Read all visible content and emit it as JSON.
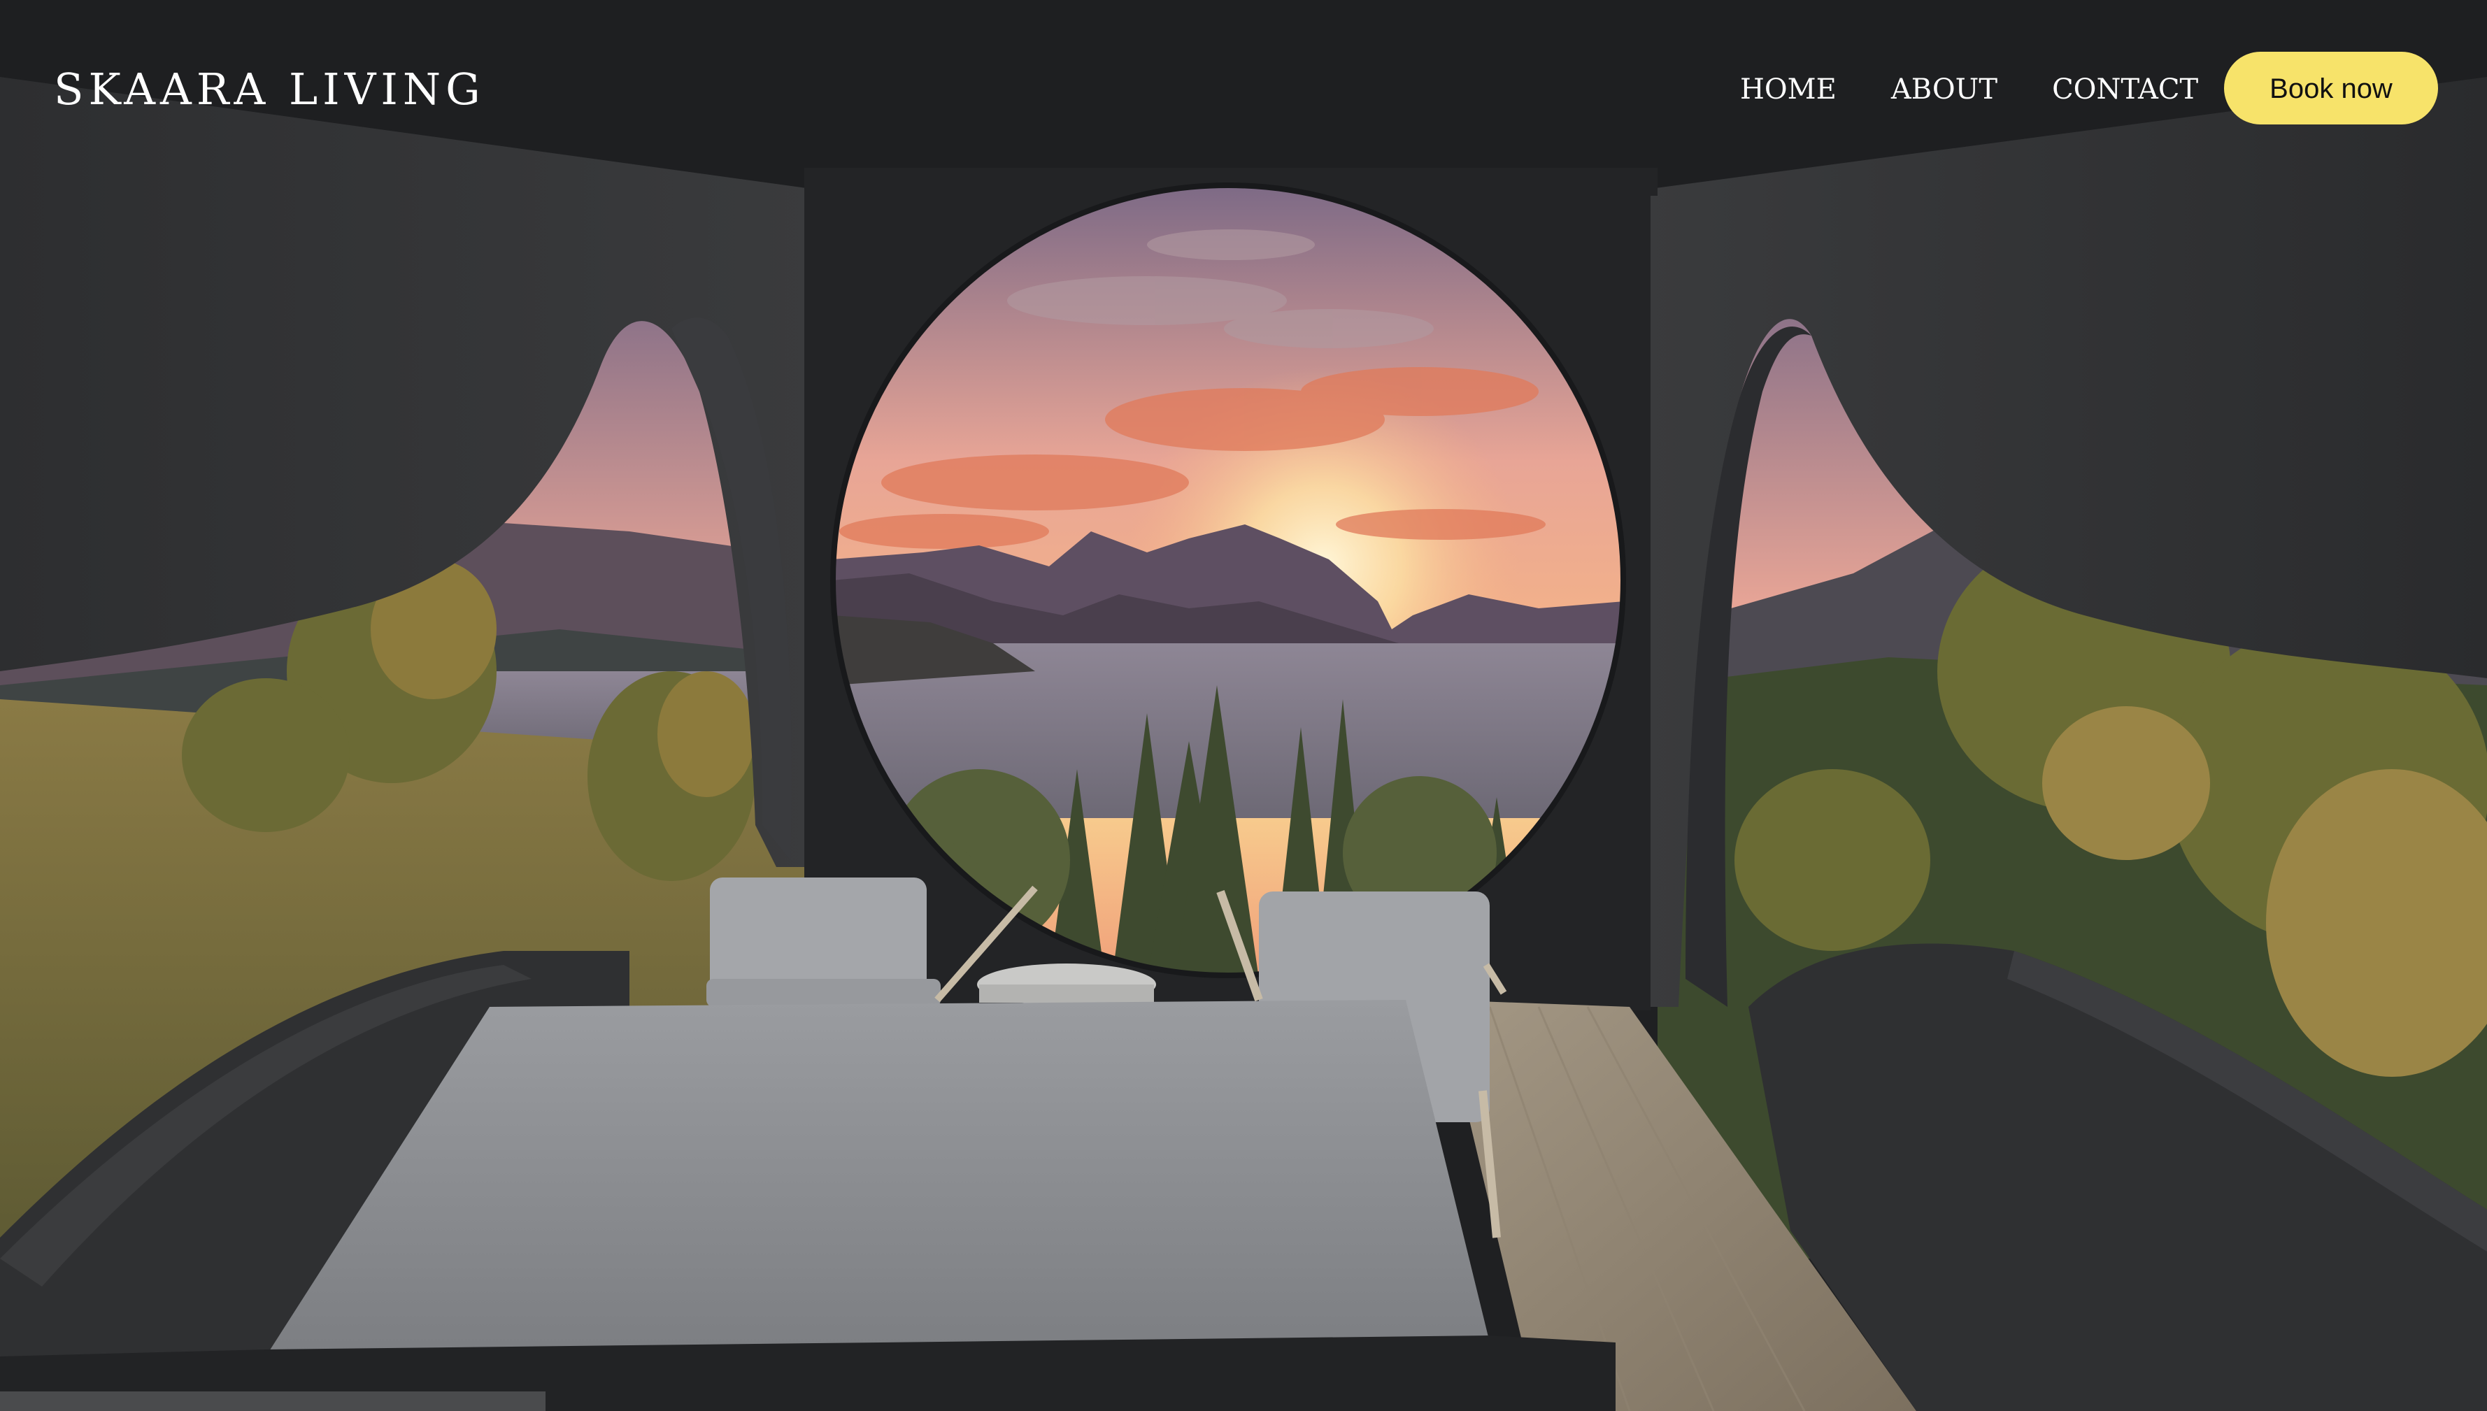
{
  "brand": {
    "name": "SKAARA LIVING"
  },
  "nav": {
    "items": [
      {
        "label": "HOME"
      },
      {
        "label": "ABOUT"
      },
      {
        "label": "CONTACT"
      }
    ],
    "cta_label": "Book now"
  },
  "colors": {
    "cta_background": "#f7e36a",
    "header_background": "#1d1e20",
    "nav_text": "#ffffff"
  },
  "hero": {
    "image": "interior-cabin-with-round-windows-overlooking-fjord-at-sunset"
  }
}
